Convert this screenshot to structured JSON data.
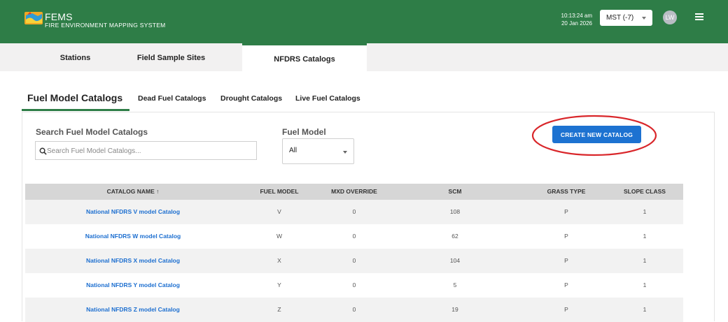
{
  "header": {
    "brand_title": "FEMS",
    "brand_subtitle": "FIRE ENVIRONMENT MAPPING SYSTEM",
    "time": "10:13:24 am",
    "date": "20 Jan 2026",
    "timezone": "MST (-7)",
    "avatar_initials": "LW",
    "menu_icon": "hamburger-menu-icon",
    "colors": {
      "header_bg": "#2e7d47",
      "accent_blue": "#1d72d1",
      "annotation_red": "#d9262a"
    }
  },
  "main_tabs": [
    {
      "label": "Stations",
      "active": false
    },
    {
      "label": "Field Sample Sites",
      "active": false
    },
    {
      "label": "NFDRS Catalogs",
      "active": true
    }
  ],
  "sub_tabs": [
    {
      "label": "Fuel Model Catalogs",
      "active": true
    },
    {
      "label": "Dead Fuel Catalogs",
      "active": false
    },
    {
      "label": "Drought Catalogs",
      "active": false
    },
    {
      "label": "Live Fuel Catalogs",
      "active": false
    }
  ],
  "search": {
    "label": "Search Fuel Model Catalogs",
    "placeholder": "Search Fuel Model Catalogs...",
    "value": ""
  },
  "fuel_model_filter": {
    "label": "Fuel Model",
    "selected": "All"
  },
  "create_button": "CREATE NEW CATALOG",
  "table": {
    "columns": [
      "CATALOG NAME ↑",
      "FUEL MODEL",
      "MXD OVERRIDE",
      "SCM",
      "GRASS TYPE",
      "SLOPE CLASS"
    ],
    "sort": {
      "column": "CATALOG NAME",
      "direction": "ascending"
    },
    "rows": [
      {
        "name": "National NFDRS V model Catalog",
        "fuel_model": "V",
        "mxd": "0",
        "scm": "108",
        "grass": "P",
        "slope": "1"
      },
      {
        "name": "National NFDRS W model Catalog",
        "fuel_model": "W",
        "mxd": "0",
        "scm": "62",
        "grass": "P",
        "slope": "1"
      },
      {
        "name": "National NFDRS X model Catalog",
        "fuel_model": "X",
        "mxd": "0",
        "scm": "104",
        "grass": "P",
        "slope": "1"
      },
      {
        "name": "National NFDRS Y model Catalog",
        "fuel_model": "Y",
        "mxd": "0",
        "scm": "5",
        "grass": "P",
        "slope": "1"
      },
      {
        "name": "National NFDRS Z model Catalog",
        "fuel_model": "Z",
        "mxd": "0",
        "scm": "19",
        "grass": "P",
        "slope": "1"
      }
    ]
  }
}
